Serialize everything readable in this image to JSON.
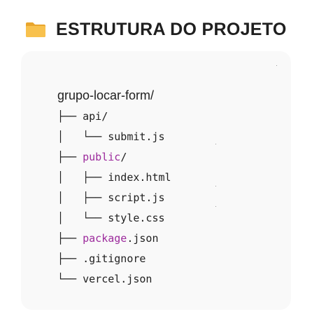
{
  "header": {
    "icon": "folder-icon",
    "title": "ESTRUTURA DO PROJETO"
  },
  "tree": {
    "root": "grupo-locar-form/",
    "rows": [
      {
        "prefix": "├── ",
        "keyword": "",
        "text": "api/"
      },
      {
        "prefix": "│   └── ",
        "keyword": "",
        "text": "submit.js"
      },
      {
        "prefix": "├── ",
        "keyword": "public",
        "text": "/"
      },
      {
        "prefix": "│   ├── ",
        "keyword": "",
        "text": "index.html"
      },
      {
        "prefix": "│   ├── ",
        "keyword": "",
        "text": "script.js"
      },
      {
        "prefix": "│   └── ",
        "keyword": "",
        "text": "style.css"
      },
      {
        "prefix": "├── ",
        "keyword": "package",
        "text": ".json"
      },
      {
        "prefix": "├── ",
        "keyword": "",
        "text": ".gitignore"
      },
      {
        "prefix": "└── ",
        "keyword": "",
        "text": "vercel.json"
      }
    ]
  },
  "colors": {
    "keyword": "#9c2a9c",
    "card_background": "#f9f9f9",
    "folder": "#f5b83d"
  }
}
